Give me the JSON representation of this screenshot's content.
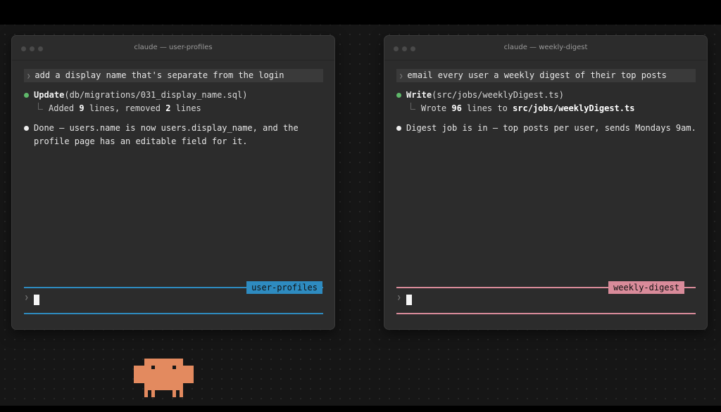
{
  "colors": {
    "accent_left": "#2e8bc0",
    "accent_right": "#d98b9a",
    "status_ok": "#5fb86a",
    "mascot": "#e38a5f"
  },
  "windows": [
    {
      "title": "claude — user-profiles",
      "prompt": "add a display name that's separate from the login",
      "tool": {
        "name": "Update",
        "arg": "(db/migrations/031_display_name.sql)",
        "result_pre": "Added ",
        "result_n1": "9",
        "result_mid": " lines, removed ",
        "result_n2": "2",
        "result_post": " lines"
      },
      "message": "Done — users.name is now users.display_name, and the\nprofile page has an editable field for it.",
      "tag": "user-profiles"
    },
    {
      "title": "claude — weekly-digest",
      "prompt": "email every user a weekly digest of their top posts",
      "tool": {
        "name": "Write",
        "arg": "(src/jobs/weeklyDigest.ts)",
        "result_pre": "Wrote ",
        "result_n1": "96",
        "result_mid": " lines to ",
        "result_path": "src/jobs/weeklyDigest.ts"
      },
      "message": "Digest job is in — top posts per user, sends Mondays 9am.",
      "tag": "weekly-digest"
    }
  ]
}
